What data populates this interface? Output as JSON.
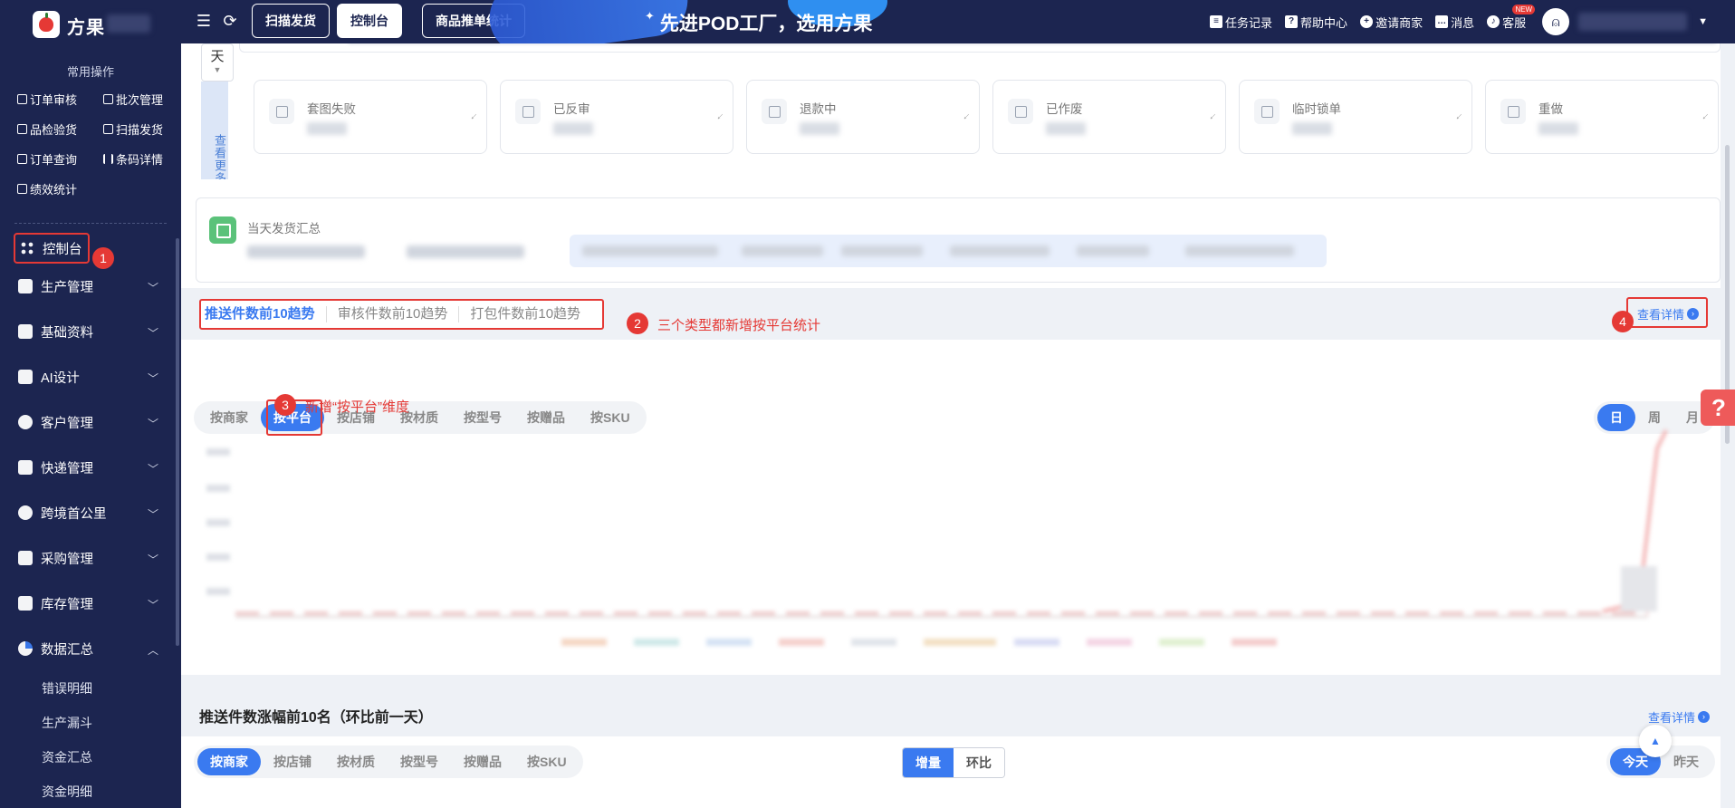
{
  "colors": {
    "nav_bg": "#1c2550",
    "accent": "#3a7af0",
    "annotation": "#e53935",
    "ship_icon": "#5bc27a"
  },
  "header": {
    "brand": "方果",
    "tabs": [
      {
        "label": "扫描发货",
        "active": false
      },
      {
        "label": "控制台",
        "active": true
      },
      {
        "label": "商品推单统计",
        "active": false
      }
    ],
    "slogan": "先进POD工厂，选用方果",
    "links": [
      {
        "label": "任务记录",
        "icon": "task-list-icon"
      },
      {
        "label": "帮助中心",
        "icon": "help-icon"
      },
      {
        "label": "邀请商家",
        "icon": "invite-user-icon"
      },
      {
        "label": "消息",
        "icon": "message-icon"
      },
      {
        "label": "客服",
        "icon": "headset-icon",
        "badge": "NEW"
      }
    ]
  },
  "sidebar": {
    "section_title": "常用操作",
    "quick": [
      "订单审核",
      "批次管理",
      "品检验货",
      "扫描发货",
      "订单查询",
      "条码详情",
      "绩效统计"
    ],
    "menu": [
      {
        "label": "控制台",
        "expandable": false
      },
      {
        "label": "生产管理",
        "expandable": true
      },
      {
        "label": "基础资料",
        "expandable": true
      },
      {
        "label": "AI设计",
        "expandable": true
      },
      {
        "label": "客户管理",
        "expandable": true
      },
      {
        "label": "快递管理",
        "expandable": true
      },
      {
        "label": "跨境首公里",
        "expandable": true
      },
      {
        "label": "采购管理",
        "expandable": true
      },
      {
        "label": "库存管理",
        "expandable": true
      },
      {
        "label": "数据汇总",
        "expandable": true,
        "expanded": true
      }
    ],
    "submenu": [
      "错误明细",
      "生产漏斗",
      "资金汇总",
      "资金明细"
    ]
  },
  "overview": {
    "day_select": "天",
    "more_label": "查看更多",
    "cards": [
      "套图失败",
      "已反审",
      "退款中",
      "已作废",
      "临时锁单",
      "重做"
    ]
  },
  "ship_summary": {
    "title": "当天发货汇总"
  },
  "trend": {
    "tabs": [
      "推送件数前10趋势",
      "审核件数前10趋势",
      "打包件数前10趋势"
    ],
    "detail": "查看详情",
    "dimensions": [
      "按商家",
      "按平台",
      "按店铺",
      "按材质",
      "按型号",
      "按赠品",
      "按SKU"
    ],
    "active_dimension": "按平台",
    "periods": [
      "日",
      "周",
      "月"
    ],
    "active_period": "日"
  },
  "annotations": {
    "m1": "1",
    "m2": "2",
    "m3": "3",
    "m4": "4",
    "note2": "三个类型都新增按平台统计",
    "note3": "新增“按平台”维度"
  },
  "growth": {
    "title": "推送件数涨幅前10名（环比前一天）",
    "detail": "查看详情",
    "dimensions": [
      "按商家",
      "按店铺",
      "按材质",
      "按型号",
      "按赠品",
      "按SKU"
    ],
    "metric": [
      "增量",
      "环比"
    ],
    "day": [
      "今天",
      "昨天"
    ]
  },
  "help_fab": "?"
}
